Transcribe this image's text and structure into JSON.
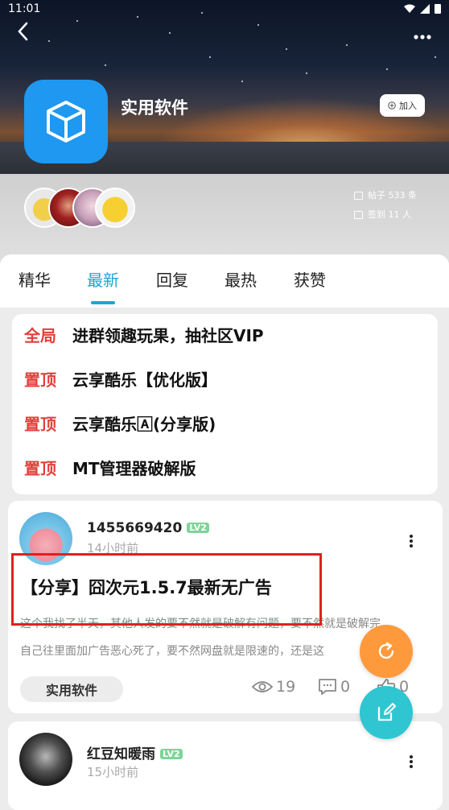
{
  "status": {
    "time": "11:01"
  },
  "forum": {
    "title": "实用软件",
    "join_label": "加入",
    "posts_stat": "帖子 533 条",
    "checkin_stat": "签到 11 人"
  },
  "tabs": [
    {
      "label": "精华"
    },
    {
      "label": "最新",
      "active": true
    },
    {
      "label": "回复"
    },
    {
      "label": "最热"
    },
    {
      "label": "获赞"
    }
  ],
  "pinned": [
    {
      "tag": "全局",
      "title": "进群领趣玩果，抽社区VIP"
    },
    {
      "tag": "置顶",
      "title": "云享酷乐【优化版】"
    },
    {
      "tag": "置顶",
      "title": "云享酷乐🄰(分享版)"
    },
    {
      "tag": "置顶",
      "title": "MT管理器破解版"
    }
  ],
  "posts": [
    {
      "username": "1455669420",
      "level": "LV2",
      "time": "14小时前",
      "title": "【分享】囧次元1.5.7最新无广告",
      "excerpt_line1": "这个我找了半天，其他人发的要不然就是破解有问题，要不然就是破解完",
      "excerpt_line2": "自己往里面加广告恶心死了，要不然网盘就是限速的，还是这",
      "category": "实用软件",
      "views": "19",
      "comments": "0",
      "likes": "0"
    },
    {
      "username": "红豆知暖雨",
      "level": "LV2",
      "time": "15小时前"
    }
  ],
  "colors": {
    "accent": "#1aa6d6",
    "pin_red": "#e2403c",
    "fab_orange": "#ff9a3c",
    "fab_teal": "#2fc6d2"
  }
}
